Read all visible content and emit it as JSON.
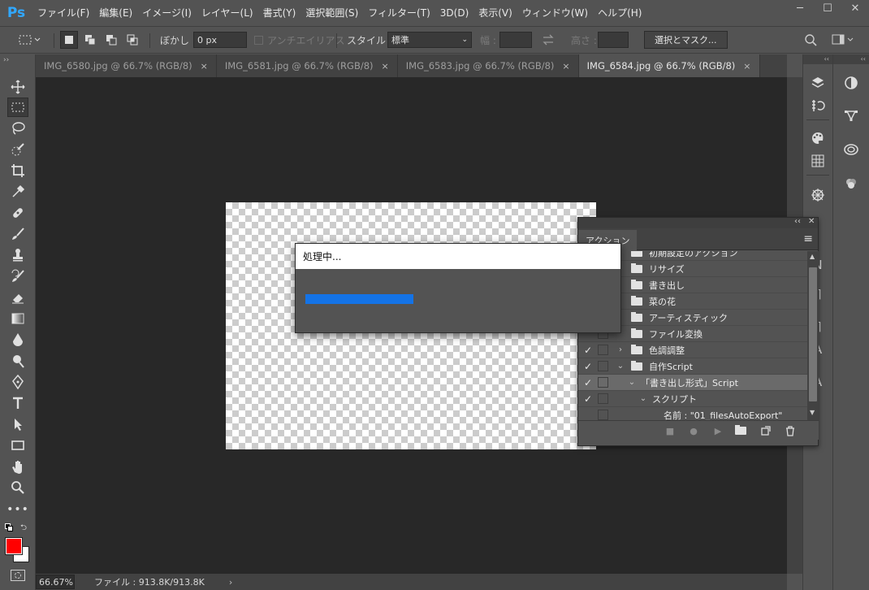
{
  "app": {
    "logo": "Ps"
  },
  "menu": [
    "ファイル(F)",
    "編集(E)",
    "イメージ(I)",
    "レイヤー(L)",
    "書式(Y)",
    "選択範囲(S)",
    "フィルター(T)",
    "3D(D)",
    "表示(V)",
    "ウィンドウ(W)",
    "ヘルプ(H)"
  ],
  "window_controls": {
    "minimize": "─",
    "maximize": "☐",
    "close": "✕"
  },
  "options": {
    "feather_label": "ぼかし :",
    "feather_value": "0 px",
    "antialias_label": "アンチエイリアス",
    "style_label": "スタイル :",
    "style_value": "標準",
    "width_label": "幅 :",
    "height_label": "高さ :",
    "select_mask_button": "選択とマスク..."
  },
  "tabs": [
    {
      "label": "IMG_6580.jpg @ 66.7% (RGB/8)",
      "close": "×",
      "active": false
    },
    {
      "label": "IMG_6581.jpg @ 66.7% (RGB/8)",
      "close": "×",
      "active": false
    },
    {
      "label": "IMG_6583.jpg @ 66.7% (RGB/8)",
      "close": "×",
      "active": false
    },
    {
      "label": "IMG_6584.jpg @ 66.7% (RGB/8)",
      "close": "×",
      "active": true
    }
  ],
  "status": {
    "zoom": "66.67%",
    "file_info": "ファイル : 913.8K/913.8K",
    "arrow": "›"
  },
  "actions_panel": {
    "tab_label": "アクション",
    "rows": [
      {
        "check": "",
        "twisty": "",
        "kind": "folder",
        "label": "初期設定のアクション"
      },
      {
        "check": "",
        "twisty": "",
        "kind": "folder",
        "label": "リサイズ"
      },
      {
        "check": "",
        "twisty": "",
        "kind": "folder",
        "label": "書き出し"
      },
      {
        "check": "",
        "twisty": "",
        "kind": "folder",
        "label": "菜の花"
      },
      {
        "check": "",
        "twisty": "",
        "kind": "folder",
        "label": "アーティスティック"
      },
      {
        "check": "",
        "twisty": "",
        "kind": "folder",
        "label": "ファイル変換"
      },
      {
        "check": "✓",
        "twisty": "›",
        "kind": "folder",
        "label": "色調調整"
      },
      {
        "check": "✓",
        "twisty": "⌄",
        "kind": "folder",
        "label": "自作Script"
      },
      {
        "check": "✓",
        "twisty": "⌄",
        "kind": "action",
        "label": "「書き出し形式」Script"
      },
      {
        "check": "✓",
        "twisty": "⌄",
        "kind": "step",
        "label": "スクリプト"
      },
      {
        "check": "",
        "twisty": "",
        "kind": "detail",
        "label": "名前 :  \"01_filesAutoExport\""
      }
    ]
  },
  "processing_dialog": {
    "title": "処理中...",
    "progress_fraction": 0.33
  },
  "colors": {
    "foreground": "#ff0000",
    "background": "#ffffff",
    "accent": "#1473e6"
  }
}
